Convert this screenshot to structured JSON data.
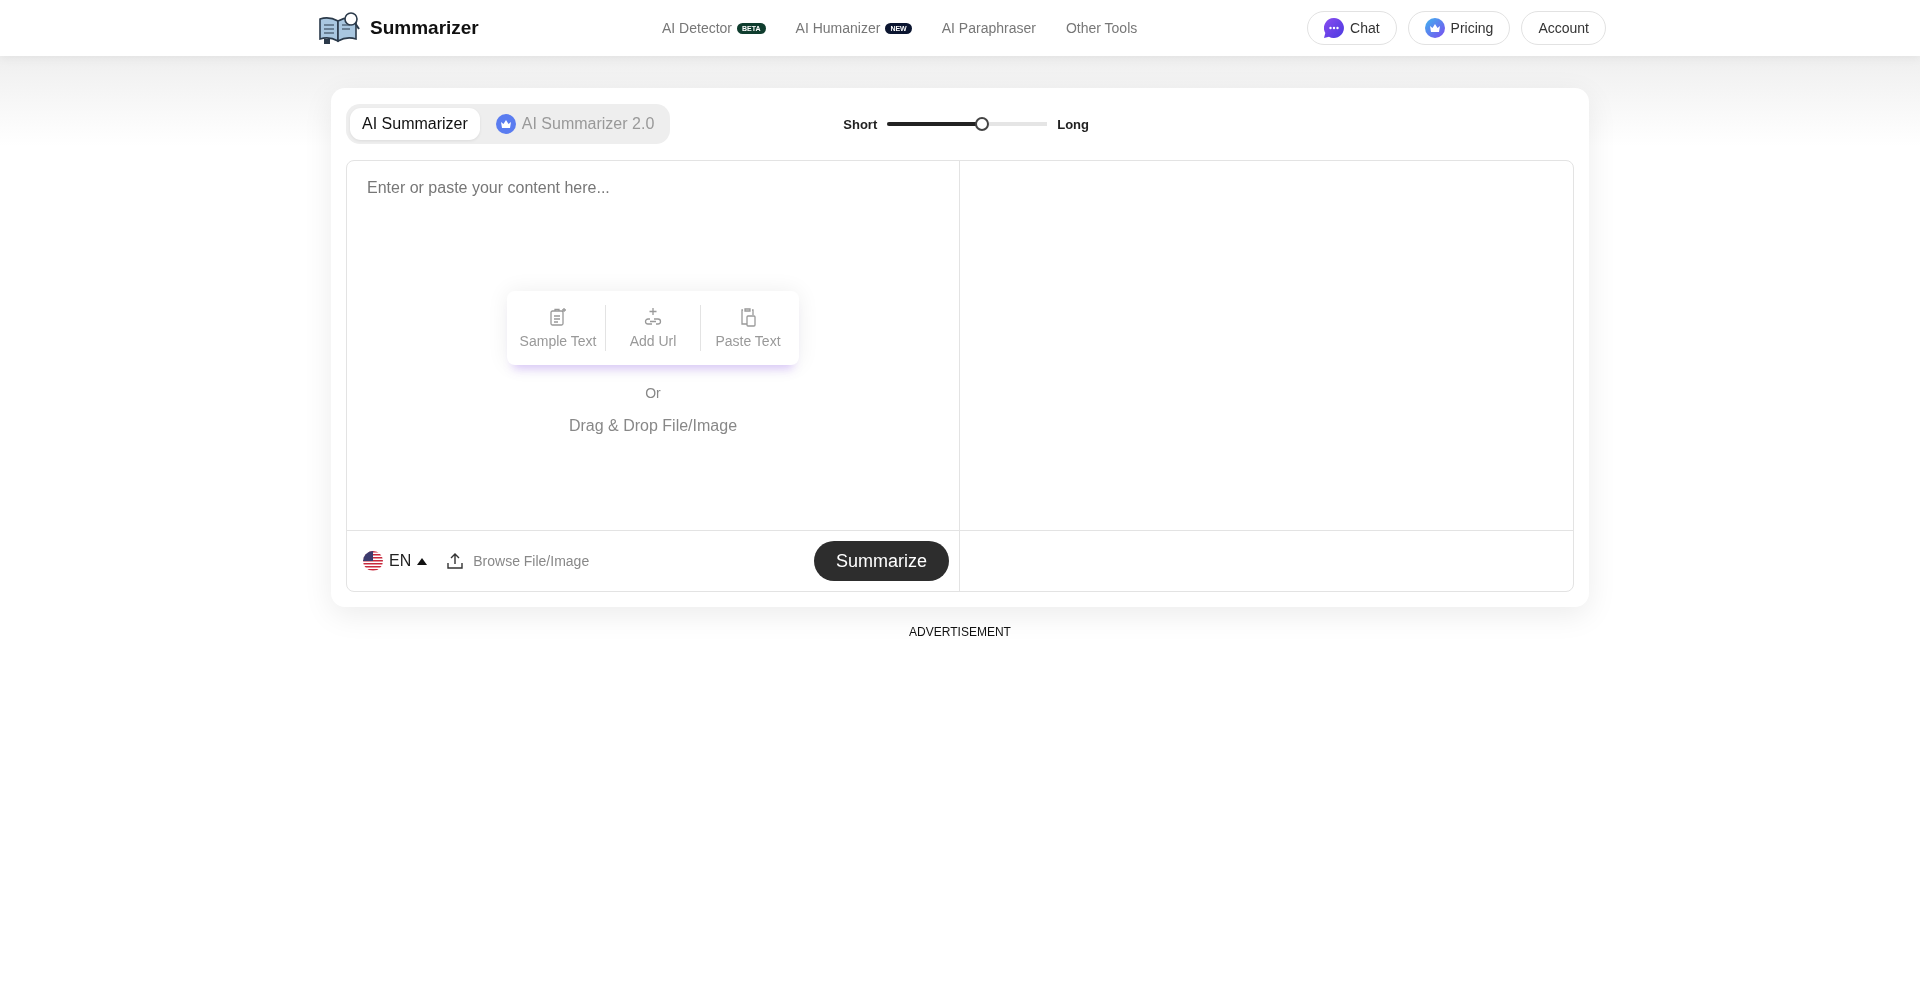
{
  "header": {
    "brand": "Summarizer",
    "nav": [
      {
        "kind": "beta",
        "label": "AI Detector",
        "badge": "BETA"
      },
      {
        "kind": "new",
        "label": "AI Humanizer",
        "badge": "NEW"
      },
      {
        "kind": "plain",
        "label": "AI Paraphraser"
      },
      {
        "kind": "plain",
        "label": "Other Tools"
      }
    ],
    "buttons": [
      {
        "kind": "chat",
        "label": "Chat"
      },
      {
        "kind": "pricing",
        "label": "Pricing"
      },
      {
        "kind": "plain",
        "label": "Account"
      }
    ]
  },
  "tabs": [
    {
      "label": "AI Summarizer",
      "selected": true,
      "icon": false
    },
    {
      "label": "AI Summarizer 2.0",
      "selected": false,
      "icon": true
    }
  ],
  "length": {
    "min_label": "Short",
    "max_label": "Long",
    "level": 0.59
  },
  "editor": {
    "placeholder": "Enter or paste your content here...",
    "actions": [
      {
        "kind": "sample",
        "label": "Sample Text"
      },
      {
        "kind": "url",
        "label": "Add Url"
      },
      {
        "kind": "paste",
        "label": "Paste Text"
      }
    ],
    "or": "Or",
    "drop": "Drag & Drop File/Image",
    "language": "EN",
    "browse": "Browse File/Image",
    "submit": "Summarize"
  },
  "advertisement": "ADVERTISEMENT"
}
